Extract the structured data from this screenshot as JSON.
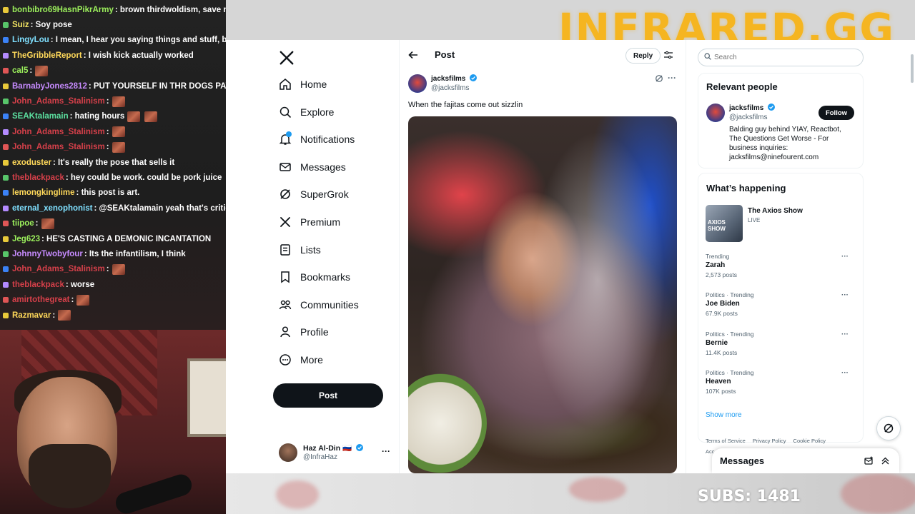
{
  "brand": "INFRARED.GG",
  "subs_text": "SUBS: 1481",
  "colors": {
    "brand": "#f5b521",
    "x_blue": "#1d9bf0",
    "x_black": "#0f1419",
    "muted": "#536471"
  },
  "chat": [
    {
      "user": "bonbibro69HasnPikrArmy",
      "color": "#9cf05c",
      "message": ": brown thirdwoldism, save meee",
      "emotes": 0
    },
    {
      "user": "Suiz",
      "color": "#f5e663",
      "message": ": Soy pose",
      "emotes": 0
    },
    {
      "user": "LingyLou",
      "color": "#7fe0ff",
      "message": ": I mean, I hear you saying things and stuff, but that",
      "emotes": 0
    },
    {
      "user": "TheGribbleReport",
      "color": "#ffd95a",
      "message": ": I wish kick actually worked",
      "emotes": 0
    },
    {
      "user": "cal5",
      "color": "#9cf05c",
      "message": ":",
      "emotes": 1
    },
    {
      "user": "BarnabyJones2812",
      "color": "#c78bff",
      "message": ": PUT YOURSELF IN THR DOGS PAWS",
      "emotes": 0
    },
    {
      "user": "John_Adams_Stalinism",
      "color": "#d6404a",
      "message": ":",
      "emotes": 1
    },
    {
      "user": "SEAKtalamain",
      "color": "#5ce0a0",
      "message": ": hating hours",
      "emotes": 2
    },
    {
      "user": "John_Adams_Stalinism",
      "color": "#d6404a",
      "message": ":",
      "emotes": 1
    },
    {
      "user": "John_Adams_Stalinism",
      "color": "#d6404a",
      "message": ":",
      "emotes": 1
    },
    {
      "user": "exoduster",
      "color": "#ffd95a",
      "message": ": It's really the pose that sells it",
      "emotes": 0
    },
    {
      "user": "theblackpack",
      "color": "#d6404a",
      "message": ": hey could be work. could be pork juice",
      "emotes": 0
    },
    {
      "user": "lemongkinglime",
      "color": "#ffd95a",
      "message": ": this post is art.",
      "emotes": 0
    },
    {
      "user": "eternal_xenophonist",
      "color": "#7fe0ff",
      "message": ": @SEAKtalamain yeah that's critical ar",
      "emotes": 0
    },
    {
      "user": "tiipoe",
      "color": "#9cf05c",
      "message": ":",
      "emotes": 1
    },
    {
      "user": "Jeg623",
      "color": "#9cf05c",
      "message": ": HE'S CASTING A DEMONIC INCANTATION",
      "emotes": 0
    },
    {
      "user": "JohnnyTwobyfour",
      "color": "#c78bff",
      "message": ": Its the infantilism, I think",
      "emotes": 0
    },
    {
      "user": "John_Adams_Stalinism",
      "color": "#d6404a",
      "message": ":",
      "emotes": 1
    },
    {
      "user": "theblackpack",
      "color": "#d6404a",
      "message": ": worse",
      "emotes": 0
    },
    {
      "user": "amirtothegreat",
      "color": "#d6404a",
      "message": ":",
      "emotes": 1
    },
    {
      "user": "Razmavar",
      "color": "#ffd95a",
      "message": ":",
      "emotes": 1
    }
  ],
  "nav": {
    "items": [
      {
        "label": "Home",
        "icon": "home-icon"
      },
      {
        "label": "Explore",
        "icon": "search-icon"
      },
      {
        "label": "Notifications",
        "icon": "bell-icon"
      },
      {
        "label": "Messages",
        "icon": "mail-icon"
      },
      {
        "label": "SuperGrok",
        "icon": "grok-icon"
      },
      {
        "label": "Premium",
        "icon": "x-icon"
      },
      {
        "label": "Lists",
        "icon": "list-icon"
      },
      {
        "label": "Bookmarks",
        "icon": "bookmark-icon"
      },
      {
        "label": "Communities",
        "icon": "people-icon"
      },
      {
        "label": "Profile",
        "icon": "person-icon"
      },
      {
        "label": "More",
        "icon": "more-circle-icon"
      }
    ],
    "post_button": "Post",
    "account": {
      "name": "Haz Al-Din 🇷🇺",
      "handle": "@InfraHaz",
      "more": "···"
    }
  },
  "post": {
    "header_title": "Post",
    "reply_label": "Reply",
    "author_name": "jacksfilms",
    "author_handle": "@jacksfilms",
    "more": "···",
    "text": "When the fajitas come out sizzlin"
  },
  "sidebar": {
    "search_placeholder": "Search",
    "relevant_title": "Relevant people",
    "relevant": {
      "name": "jacksfilms",
      "handle": "@jacksfilms",
      "follow_label": "Follow",
      "bio": "Balding guy behind YIAY, Reactbot, The Questions Get Worse - For business inquiries: jacksfilms@ninefourent.com"
    },
    "happening_title": "What’s happening",
    "axios": {
      "title": "The Axios Show",
      "status": "LIVE",
      "thumb_label": "AXIOS SHOW"
    },
    "trends": [
      {
        "meta": "Trending",
        "name": "Zarah",
        "count": "2,573 posts"
      },
      {
        "meta": "Politics · Trending",
        "name": "Joe Biden",
        "count": "67.9K posts"
      },
      {
        "meta": "Politics · Trending",
        "name": "Bernie",
        "count": "11.4K posts"
      },
      {
        "meta": "Politics · Trending",
        "name": "Heaven",
        "count": "107K posts"
      }
    ],
    "trend_more": "···",
    "show_more": "Show more",
    "footer_links": [
      "Terms of Service",
      "Privacy Policy",
      "Cookie Policy"
    ],
    "footer_cut": "Acc"
  },
  "messages_drawer": {
    "title": "Messages"
  }
}
